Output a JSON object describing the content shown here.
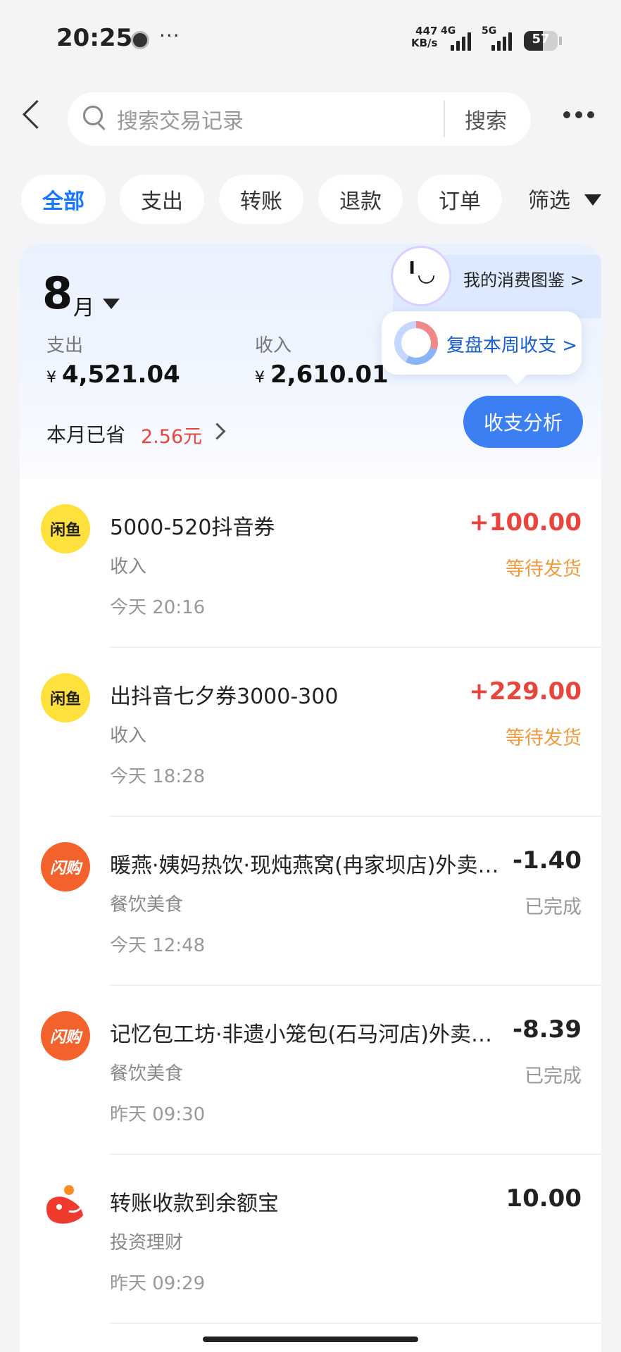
{
  "status_bar": {
    "time": "20:25",
    "more": "···",
    "net_speed_value": "447",
    "net_speed_unit": "KB/s",
    "net_4g": "4G",
    "net_5g": "5G",
    "battery": "57"
  },
  "header": {
    "search_placeholder": "搜索交易记录",
    "search_button": "搜索"
  },
  "tabs": [
    {
      "label": "全部",
      "active": true
    },
    {
      "label": "支出",
      "active": false
    },
    {
      "label": "转账",
      "active": false
    },
    {
      "label": "退款",
      "active": false
    },
    {
      "label": "订单",
      "active": false
    }
  ],
  "filter_label": "筛选",
  "summary": {
    "month": "8",
    "month_unit": "月",
    "insight_link": "我的消费图鉴 >",
    "expense_label": "支出",
    "expense_value": "4,521.04",
    "income_label": "收入",
    "income_value": "2,610.01",
    "currency": "¥",
    "review_text": "复盘本周收支 >",
    "saved_label": "本月已省",
    "saved_amount": "2.56元",
    "analysis_button": "收支分析",
    "mascot_face": "╹◡"
  },
  "transactions": [
    {
      "logo": "闲鱼",
      "title": "5000-520抖音券",
      "category": "收入",
      "time": "今天 20:16",
      "amount": "+100.00",
      "status": "等待发货"
    },
    {
      "logo": "闲鱼",
      "title": "出抖音七夕券3000-300",
      "category": "收入",
      "time": "今天 18:28",
      "amount": "+229.00",
      "status": "等待发货"
    },
    {
      "logo": "闪购",
      "title": "暖燕·姨妈热饮·现炖燕窝(冉家坝店)外卖订单",
      "category": "餐饮美食",
      "time": "今天 12:48",
      "amount": "-1.40",
      "status": "已完成"
    },
    {
      "logo": "闪购",
      "title": "记忆包工坊·非遗小笼包(石马河店)外卖订单",
      "category": "餐饮美食",
      "time": "昨天 09:30",
      "amount": "-8.39",
      "status": "已完成"
    },
    {
      "logo": "",
      "title": "转账收款到余额宝",
      "category": "投资理财",
      "time": "昨天 09:29",
      "amount": "10.00",
      "status": ""
    }
  ],
  "colors": {
    "accent": "#1677ff",
    "income": "#e8453c",
    "pending": "#f19a3e",
    "analysis_button": "#3c7ff2"
  }
}
